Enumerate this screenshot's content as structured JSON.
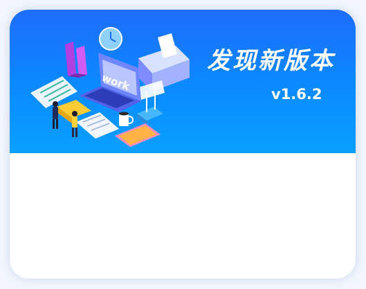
{
  "dialog": {
    "title": "发现新版本",
    "version": "v1.6.2",
    "illustration_text": "work"
  },
  "colors": {
    "banner_top": "#1e6dfb",
    "banner_bottom": "#0aa0ff",
    "body": "#ffffff"
  }
}
